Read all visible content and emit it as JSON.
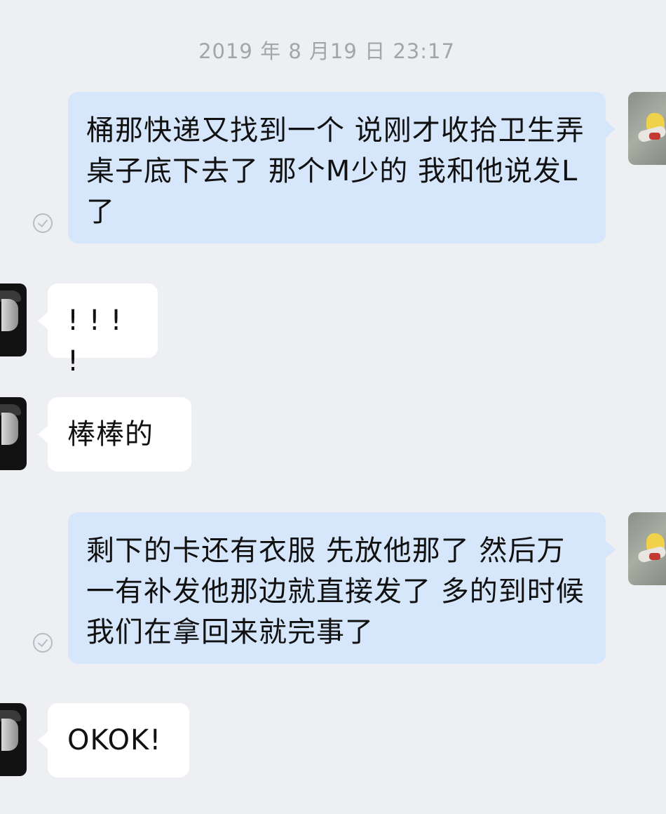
{
  "chat": {
    "timestamp": "2019 年 8 月19 日 23:17",
    "messages": [
      {
        "sender": "self",
        "read": true,
        "text": "桶那快递又找到一个 说刚才收拾卫生弄桌子底下去了 那个M少的 我和他说发L了"
      },
      {
        "sender": "peer",
        "text": "! ! ! !"
      },
      {
        "sender": "peer",
        "text": "棒棒的"
      },
      {
        "sender": "self",
        "read": true,
        "text": "剩下的卡还有衣服 先放他那了 然后万一有补发他那边就直接发了 多的到时候我们在拿回来就完事了"
      },
      {
        "sender": "peer",
        "text": "OKOK!"
      }
    ]
  }
}
